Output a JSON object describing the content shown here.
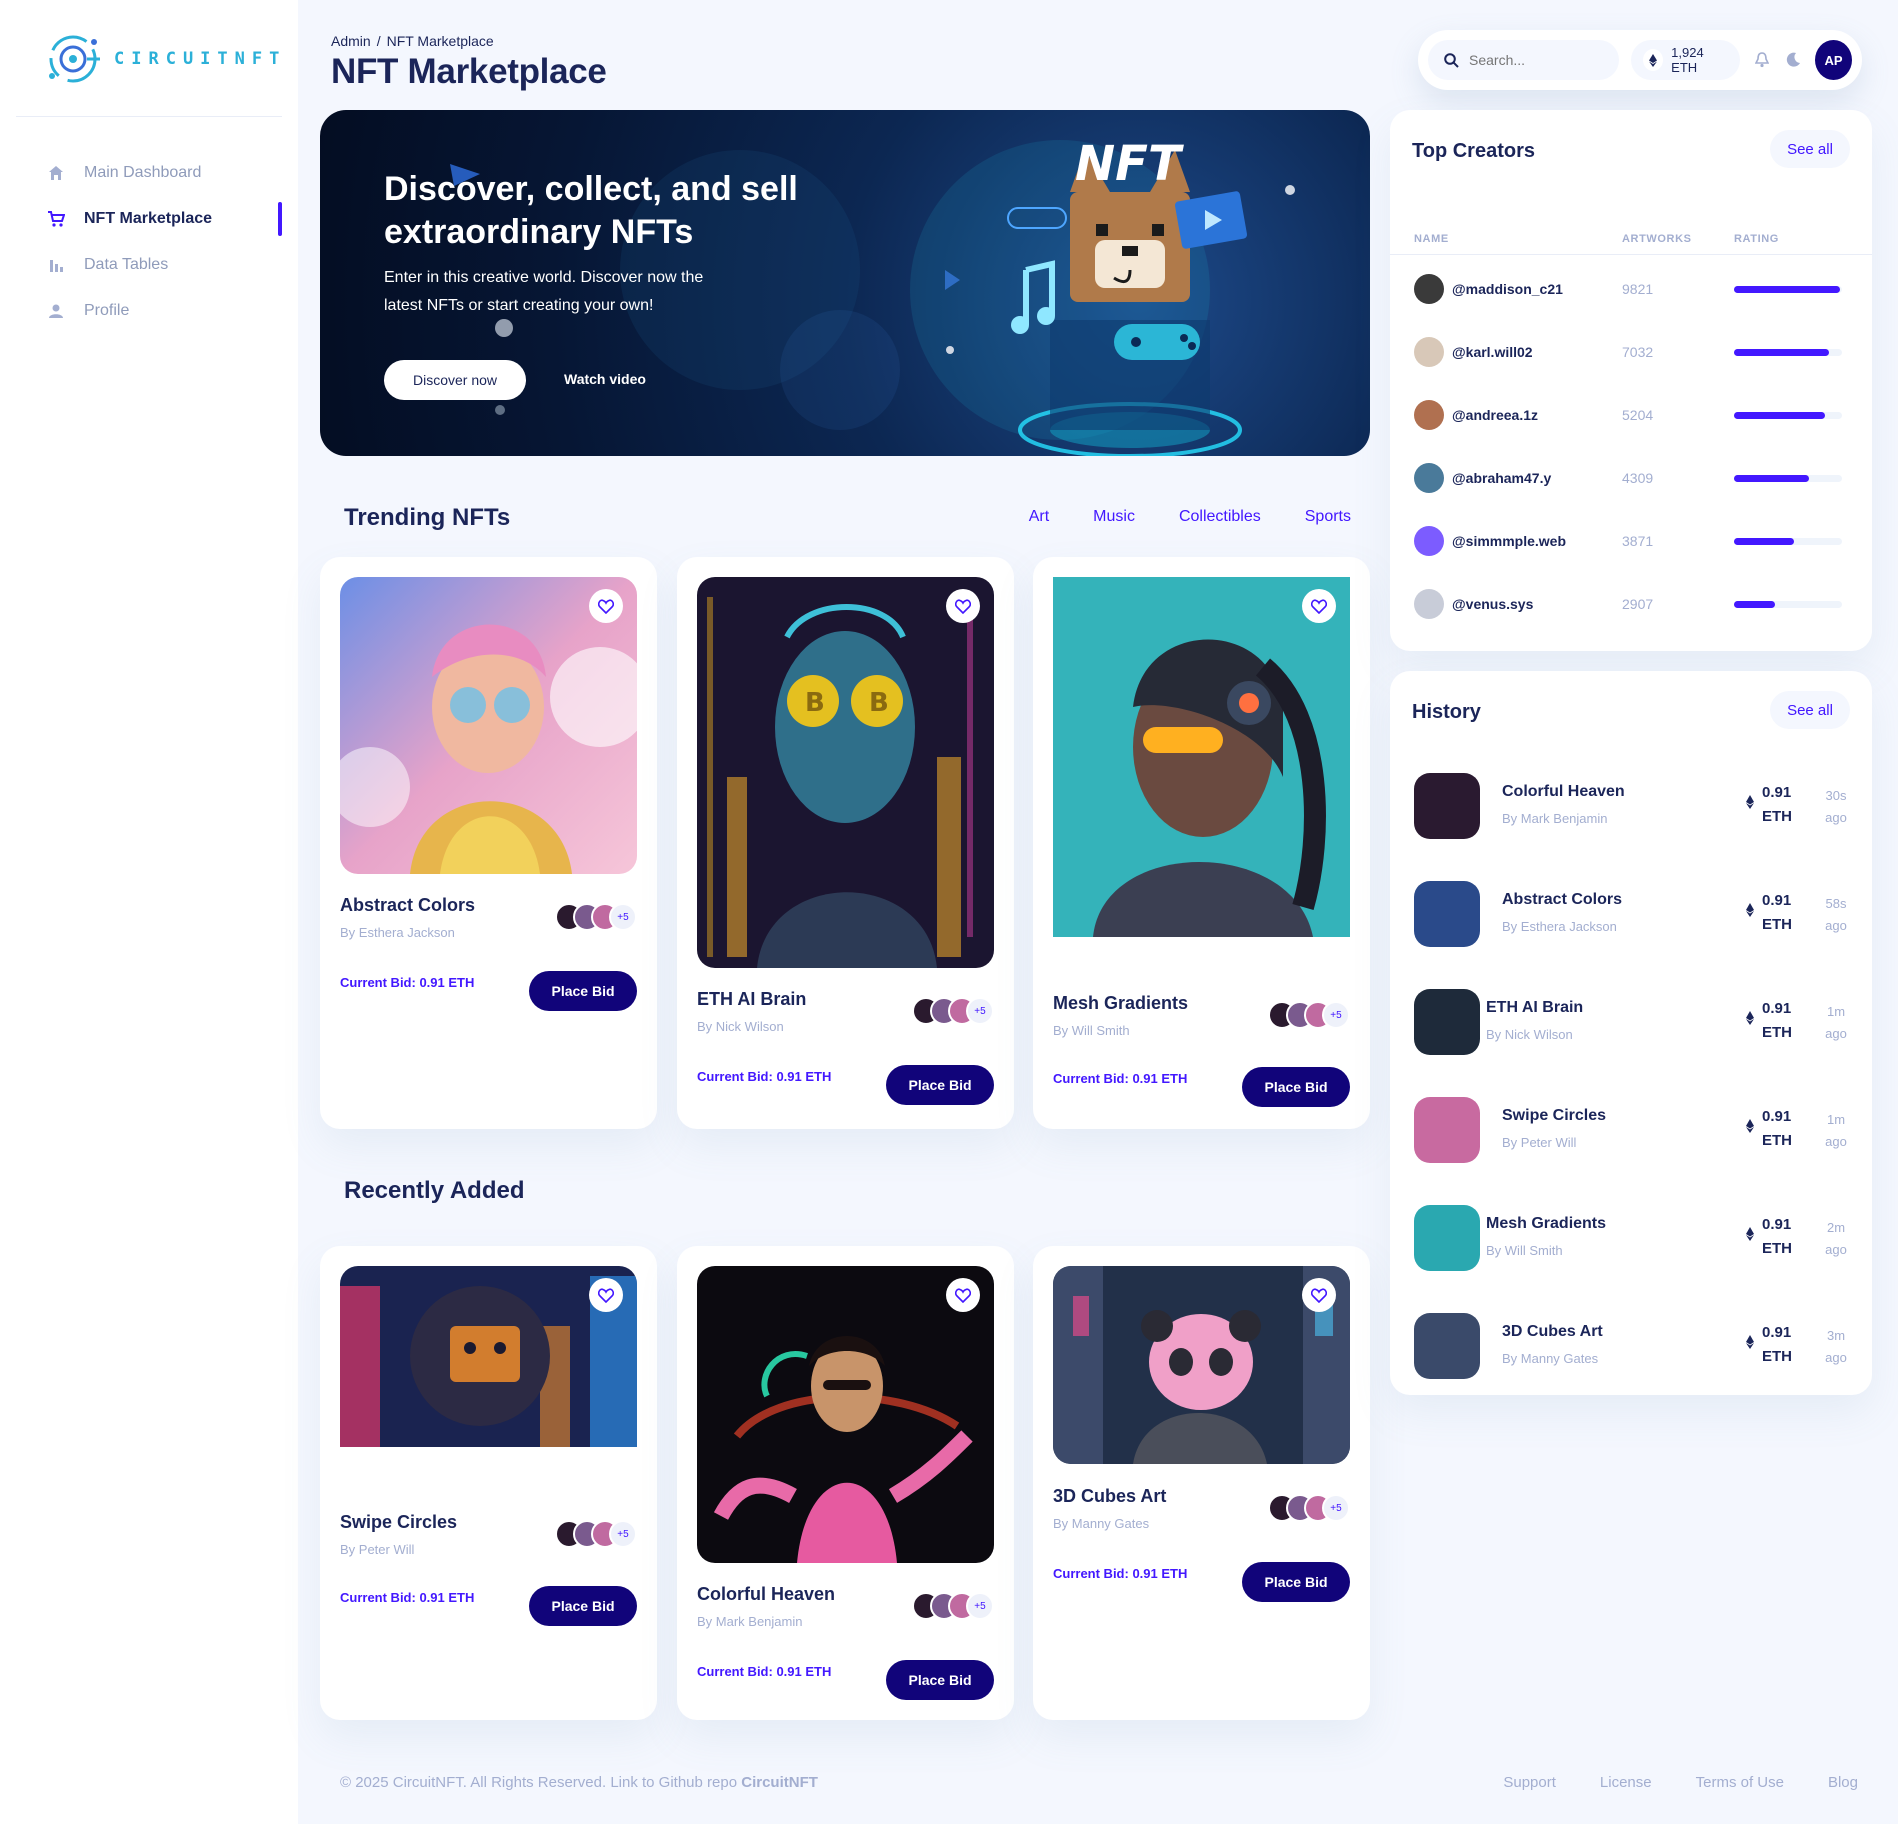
{
  "brand": {
    "name": "CIRCUITNFT"
  },
  "sidebar": {
    "items": [
      {
        "label": "Main Dashboard",
        "icon": "home-icon"
      },
      {
        "label": "NFT Marketplace",
        "icon": "cart-icon"
      },
      {
        "label": "Data Tables",
        "icon": "bar-chart-icon"
      },
      {
        "label": "Profile",
        "icon": "person-icon"
      }
    ]
  },
  "header": {
    "breadcrumb": [
      "Admin",
      "/",
      "NFT Marketplace"
    ],
    "title": "NFT Marketplace",
    "search_placeholder": "Search...",
    "eth_balance": "1,924 ETH",
    "avatar_initials": "AP"
  },
  "hero": {
    "title": "Discover, collect, and sell extraordinary NFTs",
    "subtitle": "Enter in this creative world. Discover now the latest NFTs or start creating your own!",
    "primary_button": "Discover now",
    "secondary_button": "Watch video",
    "art_text": "NFT"
  },
  "trending": {
    "title": "Trending NFTs",
    "filters": [
      "Art",
      "Music",
      "Collectibles",
      "Sports"
    ],
    "cards": [
      {
        "name": "Abstract Colors",
        "author": "By Esthera Jackson",
        "bid": "Current Bid: 0.91 ETH",
        "button": "Place Bid",
        "more": "+5"
      },
      {
        "name": "ETH AI Brain",
        "author": "By Nick Wilson",
        "bid": "Current Bid: 0.91 ETH",
        "button": "Place Bid",
        "more": "+5"
      },
      {
        "name": "Mesh Gradients",
        "author": "By Will Smith",
        "bid": "Current Bid: 0.91 ETH",
        "button": "Place Bid",
        "more": "+5"
      }
    ]
  },
  "recent": {
    "title": "Recently Added",
    "cards": [
      {
        "name": "Swipe Circles",
        "author": "By Peter Will",
        "bid": "Current Bid: 0.91 ETH",
        "button": "Place Bid",
        "more": "+5"
      },
      {
        "name": "Colorful Heaven",
        "author": "By Mark Benjamin",
        "bid": "Current Bid: 0.91 ETH",
        "button": "Place Bid",
        "more": "+5"
      },
      {
        "name": "3D Cubes Art",
        "author": "By Manny Gates",
        "bid": "Current Bid: 0.91 ETH",
        "button": "Place Bid",
        "more": "+5"
      }
    ]
  },
  "top_creators": {
    "title": "Top Creators",
    "see_all": "See all",
    "columns": [
      "NAME",
      "ARTWORKS",
      "RATING"
    ],
    "rows": [
      {
        "handle": "@maddison_c21",
        "artworks": "9821",
        "rating": 0.98
      },
      {
        "handle": "@karl.will02",
        "artworks": "7032",
        "rating": 0.88
      },
      {
        "handle": "@andreea.1z",
        "artworks": "5204",
        "rating": 0.84
      },
      {
        "handle": "@abraham47.y",
        "artworks": "4309",
        "rating": 0.69
      },
      {
        "handle": "@simmmple.web",
        "artworks": "3871",
        "rating": 0.56
      },
      {
        "handle": "@venus.sys",
        "artworks": "2907",
        "rating": 0.38
      }
    ]
  },
  "history": {
    "title": "History",
    "see_all": "See all",
    "items": [
      {
        "title": "Colorful Heaven",
        "author": "By Mark Benjamin",
        "amount": "0.91",
        "unit": "ETH",
        "time": "30s",
        "ago": "ago"
      },
      {
        "title": "Abstract Colors",
        "author": "By Esthera Jackson",
        "amount": "0.91",
        "unit": "ETH",
        "time": "58s",
        "ago": "ago"
      },
      {
        "title": "ETH AI Brain",
        "author": "By Nick Wilson",
        "amount": "0.91",
        "unit": "ETH",
        "time": "1m",
        "ago": "ago"
      },
      {
        "title": "Swipe Circles",
        "author": "By Peter Will",
        "amount": "0.91",
        "unit": "ETH",
        "time": "1m",
        "ago": "ago"
      },
      {
        "title": "Mesh Gradients",
        "author": "By Will Smith",
        "amount": "0.91",
        "unit": "ETH",
        "time": "2m",
        "ago": "ago"
      },
      {
        "title": "3D Cubes Art",
        "author": "By Manny Gates",
        "amount": "0.91",
        "unit": "ETH",
        "time": "3m",
        "ago": "ago"
      }
    ]
  },
  "footer": {
    "copyright": "© 2025 CircuitNFT. All Rights Reserved. Link to Github repo",
    "repo": "CircuitNFT",
    "links": [
      "Support",
      "License",
      "Terms of Use",
      "Blog"
    ]
  },
  "colors": {
    "accent": "#4318ff",
    "navy": "#11047a",
    "text": "#1b2559",
    "muted": "#a3aed0",
    "bg": "#f4f7fe"
  }
}
